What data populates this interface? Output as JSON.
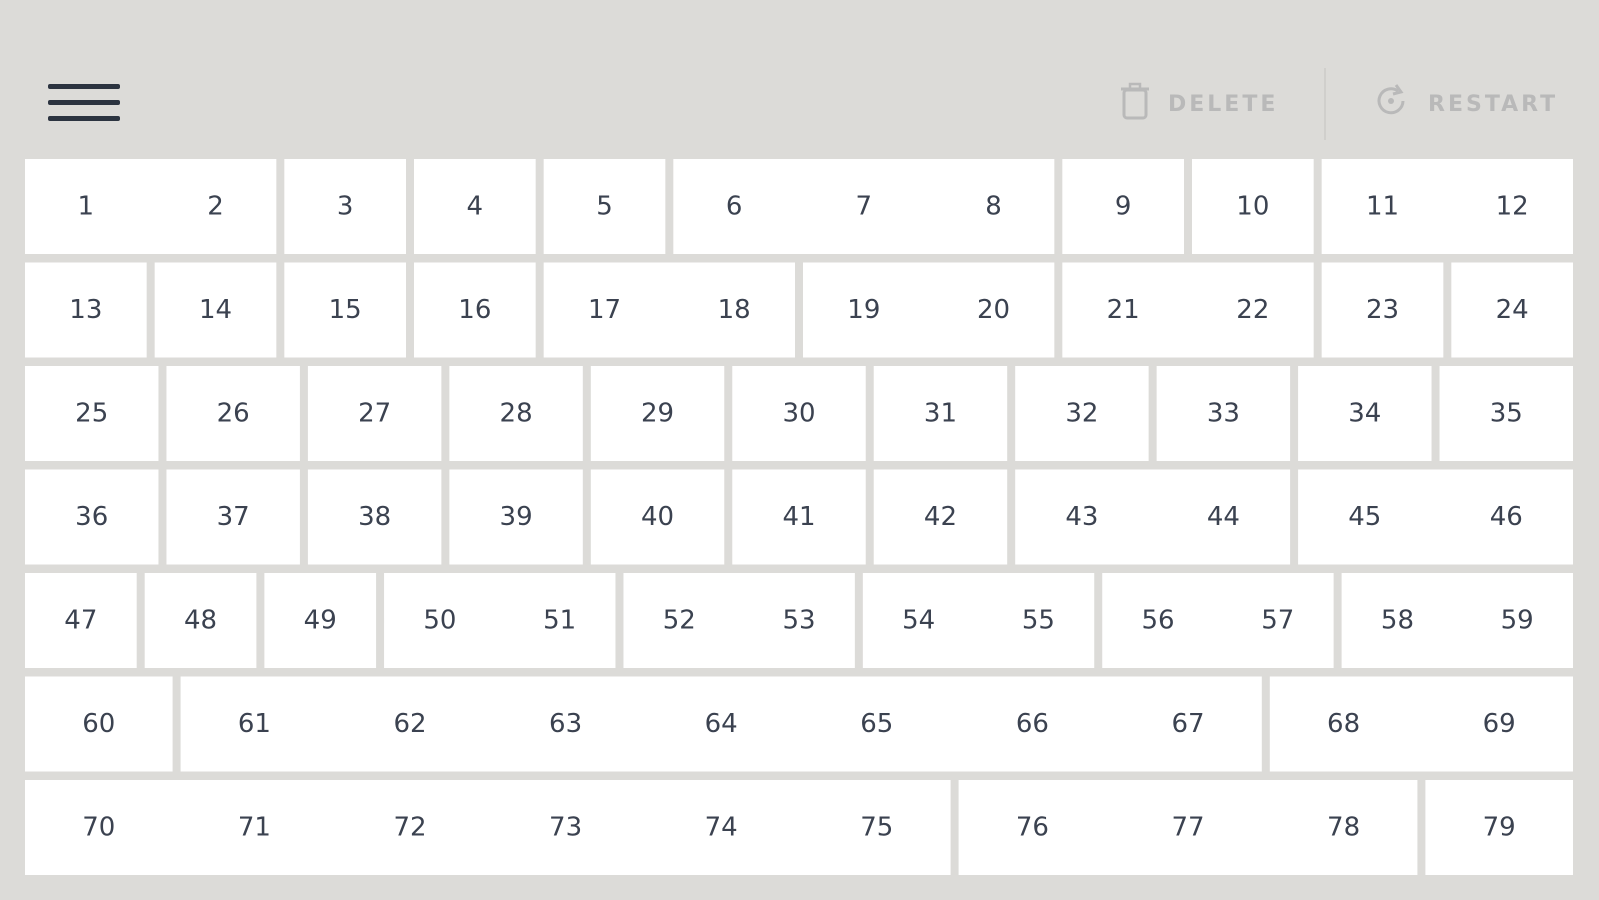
{
  "toolbar": {
    "delete_label": "DELETE",
    "restart_label": "RESTART",
    "menu_icon": "hamburger-menu-icon",
    "delete_icon": "trash-icon",
    "restart_icon": "restart-icon"
  },
  "colors": {
    "background": "#dcdbd8",
    "tile": "#ffffff",
    "tile_text": "#3b4250",
    "toolbar_text_disabled": "#b9b9b9",
    "menu_icon": "#2c3440"
  },
  "rows": [
    {
      "tiles": [
        {
          "label": "1",
          "left": "flat",
          "right": "out"
        },
        {
          "label": "2",
          "left": "in",
          "right": "flat"
        },
        {
          "label": "3",
          "left": "flat",
          "right": "flat"
        },
        {
          "label": "4",
          "left": "flat",
          "right": "flat"
        },
        {
          "label": "5",
          "left": "flat",
          "right": "flat"
        },
        {
          "label": "6",
          "left": "flat",
          "right": "in"
        },
        {
          "label": "7",
          "left": "out",
          "right": "out"
        },
        {
          "label": "8",
          "left": "in",
          "right": "flat"
        },
        {
          "label": "9",
          "left": "flat",
          "right": "flat"
        },
        {
          "label": "10",
          "left": "flat",
          "right": "flat"
        },
        {
          "label": "11",
          "left": "flat",
          "right": "in"
        },
        {
          "label": "12",
          "left": "out",
          "right": "flat"
        }
      ]
    },
    {
      "tiles": [
        {
          "label": "13",
          "left": "flat",
          "right": "flat"
        },
        {
          "label": "14",
          "left": "flat",
          "right": "flat"
        },
        {
          "label": "15",
          "left": "flat",
          "right": "flat"
        },
        {
          "label": "16",
          "left": "flat",
          "right": "flat"
        },
        {
          "label": "17",
          "left": "flat",
          "right": "in"
        },
        {
          "label": "18",
          "left": "out",
          "right": "flat"
        },
        {
          "label": "19",
          "left": "flat",
          "right": "out"
        },
        {
          "label": "20",
          "left": "in",
          "right": "flat"
        },
        {
          "label": "21",
          "left": "flat",
          "right": "out"
        },
        {
          "label": "22",
          "left": "in",
          "right": "flat"
        },
        {
          "label": "23",
          "left": "flat",
          "right": "flat"
        },
        {
          "label": "24",
          "left": "flat",
          "right": "flat"
        }
      ]
    },
    {
      "tiles": [
        {
          "label": "25",
          "left": "flat",
          "right": "flat"
        },
        {
          "label": "26",
          "left": "flat",
          "right": "flat"
        },
        {
          "label": "27",
          "left": "flat",
          "right": "flat"
        },
        {
          "label": "28",
          "left": "flat",
          "right": "flat"
        },
        {
          "label": "29",
          "left": "flat",
          "right": "flat"
        },
        {
          "label": "30",
          "left": "flat",
          "right": "flat"
        },
        {
          "label": "31",
          "left": "flat",
          "right": "flat"
        },
        {
          "label": "32",
          "left": "flat",
          "right": "flat"
        },
        {
          "label": "33",
          "left": "flat",
          "right": "flat"
        },
        {
          "label": "34",
          "left": "flat",
          "right": "flat"
        },
        {
          "label": "35",
          "left": "flat",
          "right": "flat"
        }
      ]
    },
    {
      "tiles": [
        {
          "label": "36",
          "left": "flat",
          "right": "flat"
        },
        {
          "label": "37",
          "left": "flat",
          "right": "flat"
        },
        {
          "label": "38",
          "left": "flat",
          "right": "flat"
        },
        {
          "label": "39",
          "left": "flat",
          "right": "flat"
        },
        {
          "label": "40",
          "left": "flat",
          "right": "flat"
        },
        {
          "label": "41",
          "left": "flat",
          "right": "flat"
        },
        {
          "label": "42",
          "left": "flat",
          "right": "flat"
        },
        {
          "label": "43",
          "left": "flat",
          "right": "in"
        },
        {
          "label": "44",
          "left": "out",
          "right": "flat"
        },
        {
          "label": "45",
          "left": "flat",
          "right": "in"
        },
        {
          "label": "46",
          "left": "out",
          "right": "flat"
        }
      ]
    },
    {
      "tiles": [
        {
          "label": "47",
          "left": "flat",
          "right": "flat"
        },
        {
          "label": "48",
          "left": "flat",
          "right": "flat"
        },
        {
          "label": "49",
          "left": "flat",
          "right": "flat"
        },
        {
          "label": "50",
          "left": "flat",
          "right": "out"
        },
        {
          "label": "51",
          "left": "in",
          "right": "flat"
        },
        {
          "label": "52",
          "left": "flat",
          "right": "out"
        },
        {
          "label": "53",
          "left": "in",
          "right": "flat"
        },
        {
          "label": "54",
          "left": "flat",
          "right": "in"
        },
        {
          "label": "55",
          "left": "out",
          "right": "flat"
        },
        {
          "label": "56",
          "left": "flat",
          "right": "in"
        },
        {
          "label": "57",
          "left": "out",
          "right": "flat"
        },
        {
          "label": "58",
          "left": "flat",
          "right": "out"
        },
        {
          "label": "59",
          "left": "in",
          "right": "flat"
        }
      ]
    },
    {
      "tiles": [
        {
          "label": "60",
          "left": "flat",
          "right": "flat"
        },
        {
          "label": "61",
          "left": "flat",
          "right": "out"
        },
        {
          "label": "62",
          "left": "in",
          "right": "in"
        },
        {
          "label": "63",
          "left": "out",
          "right": "out"
        },
        {
          "label": "64",
          "left": "in",
          "right": "out"
        },
        {
          "label": "65",
          "left": "in",
          "right": "in"
        },
        {
          "label": "66",
          "left": "out",
          "right": "out"
        },
        {
          "label": "67",
          "left": "in",
          "right": "flat"
        },
        {
          "label": "68",
          "left": "flat",
          "right": "in"
        },
        {
          "label": "69",
          "left": "out",
          "right": "flat"
        }
      ]
    },
    {
      "tiles": [
        {
          "label": "70",
          "left": "flat",
          "right": "in"
        },
        {
          "label": "71",
          "left": "out",
          "right": "in"
        },
        {
          "label": "72",
          "left": "out",
          "right": "in"
        },
        {
          "label": "73",
          "left": "out",
          "right": "in"
        },
        {
          "label": "74",
          "left": "out",
          "right": "in"
        },
        {
          "label": "75",
          "left": "out",
          "right": "flat"
        },
        {
          "label": "76",
          "left": "flat",
          "right": "out"
        },
        {
          "label": "77",
          "left": "in",
          "right": "out"
        },
        {
          "label": "78",
          "left": "in",
          "right": "flat"
        },
        {
          "label": "79",
          "left": "flat",
          "right": "flat"
        }
      ]
    }
  ]
}
